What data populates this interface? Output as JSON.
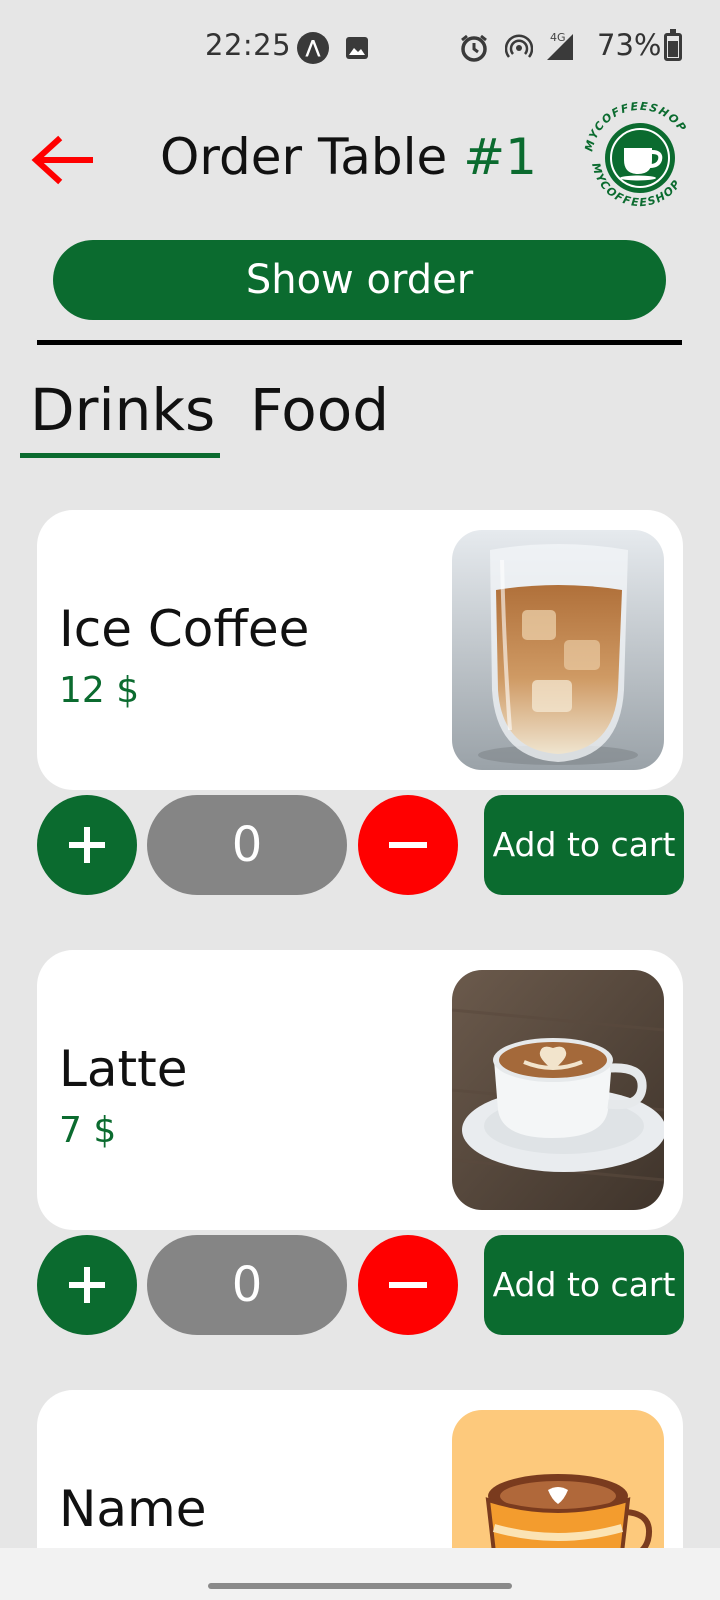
{
  "status_bar": {
    "time": "22:25",
    "network": "4G",
    "battery": "73%",
    "icons": [
      "a-notification-icon",
      "image-icon",
      "alarm-icon",
      "hotspot-icon",
      "signal-icon",
      "battery-icon"
    ]
  },
  "header": {
    "title": "Order Table",
    "table_number": "#1",
    "logo_text": "MYCOFFEESHOP",
    "back_icon": "arrow-left-icon",
    "back_color": "#ff0000"
  },
  "show_order_label": "Show order",
  "tabs": [
    {
      "label": "Drinks",
      "active": true
    },
    {
      "label": "Food",
      "active": false
    }
  ],
  "products": [
    {
      "name": "Ice Coffee",
      "price": "12 $",
      "quantity": "0",
      "add_label": "Add to cart"
    },
    {
      "name": "Latte",
      "price": "7 $",
      "quantity": "0",
      "add_label": "Add to cart"
    },
    {
      "name": "Name"
    }
  ],
  "colors": {
    "primary_green": "#0b6b2f",
    "minus_red": "#ff0000",
    "qty_gray": "#858585",
    "background": "#e6e6e6"
  }
}
